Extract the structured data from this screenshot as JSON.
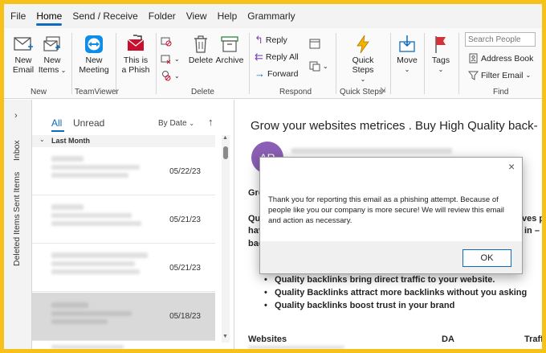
{
  "menubar": {
    "items": [
      "File",
      "Home",
      "Send / Receive",
      "Folder",
      "View",
      "Help",
      "Grammarly"
    ],
    "active": "Home"
  },
  "ribbon": {
    "new_email": "New\nEmail",
    "new_items": "New\nItems",
    "new_meeting": "New\nMeeting",
    "phish": "This is\na Phish",
    "delete": "Delete",
    "archive": "Archive",
    "reply": "Reply",
    "reply_all": "Reply All",
    "forward": "Forward",
    "quick_steps": "Quick\nSteps",
    "move": "Move",
    "tags": "Tags",
    "search_people_placeholder": "Search People",
    "address_book": "Address Book",
    "filter_email": "Filter Email",
    "groups": {
      "new": "New",
      "teamviewer": "TeamViewer",
      "delete": "Delete",
      "respond": "Respond",
      "quick_steps": "Quick Steps",
      "find": "Find"
    }
  },
  "nav": {
    "inbox": "Inbox",
    "sent": "Sent Items",
    "deleted": "Deleted Items"
  },
  "list": {
    "tab_all": "All",
    "tab_unread": "Unread",
    "sort": "By Date",
    "group_header": "Last Month",
    "items": [
      {
        "date": "05/22/23",
        "selected": false
      },
      {
        "date": "05/21/23",
        "selected": false
      },
      {
        "date": "05/21/23",
        "selected": false
      },
      {
        "date": "05/18/23",
        "selected": true
      }
    ]
  },
  "reading": {
    "subject": "Grow your websites metrices . Buy High Quality back-",
    "avatar": "AR",
    "greeting": "Gre",
    "para_left_1": "Qua",
    "para_left_2": "hav",
    "para_left_3": "bac",
    "para_right_1": "ves p",
    "para_right_2": "in –",
    "bullets": [
      "Quality backlinks bring direct traffic to your website.",
      "Quality Backlinks attract more backlinks without you asking",
      "Quality backlinks boost trust in your brand"
    ],
    "table_headers": {
      "websites": "Websites",
      "da": "DA",
      "traffic": "Traffi"
    }
  },
  "dialog": {
    "message": "Thank you for reporting this email as a phishing attempt. Because of people like you our company is more secure! We will review this email and action as necessary.",
    "ok": "OK"
  },
  "colors": {
    "accent": "#0f6cbd",
    "frame": "#f6c21a",
    "avatar": "#8b5fb5"
  }
}
